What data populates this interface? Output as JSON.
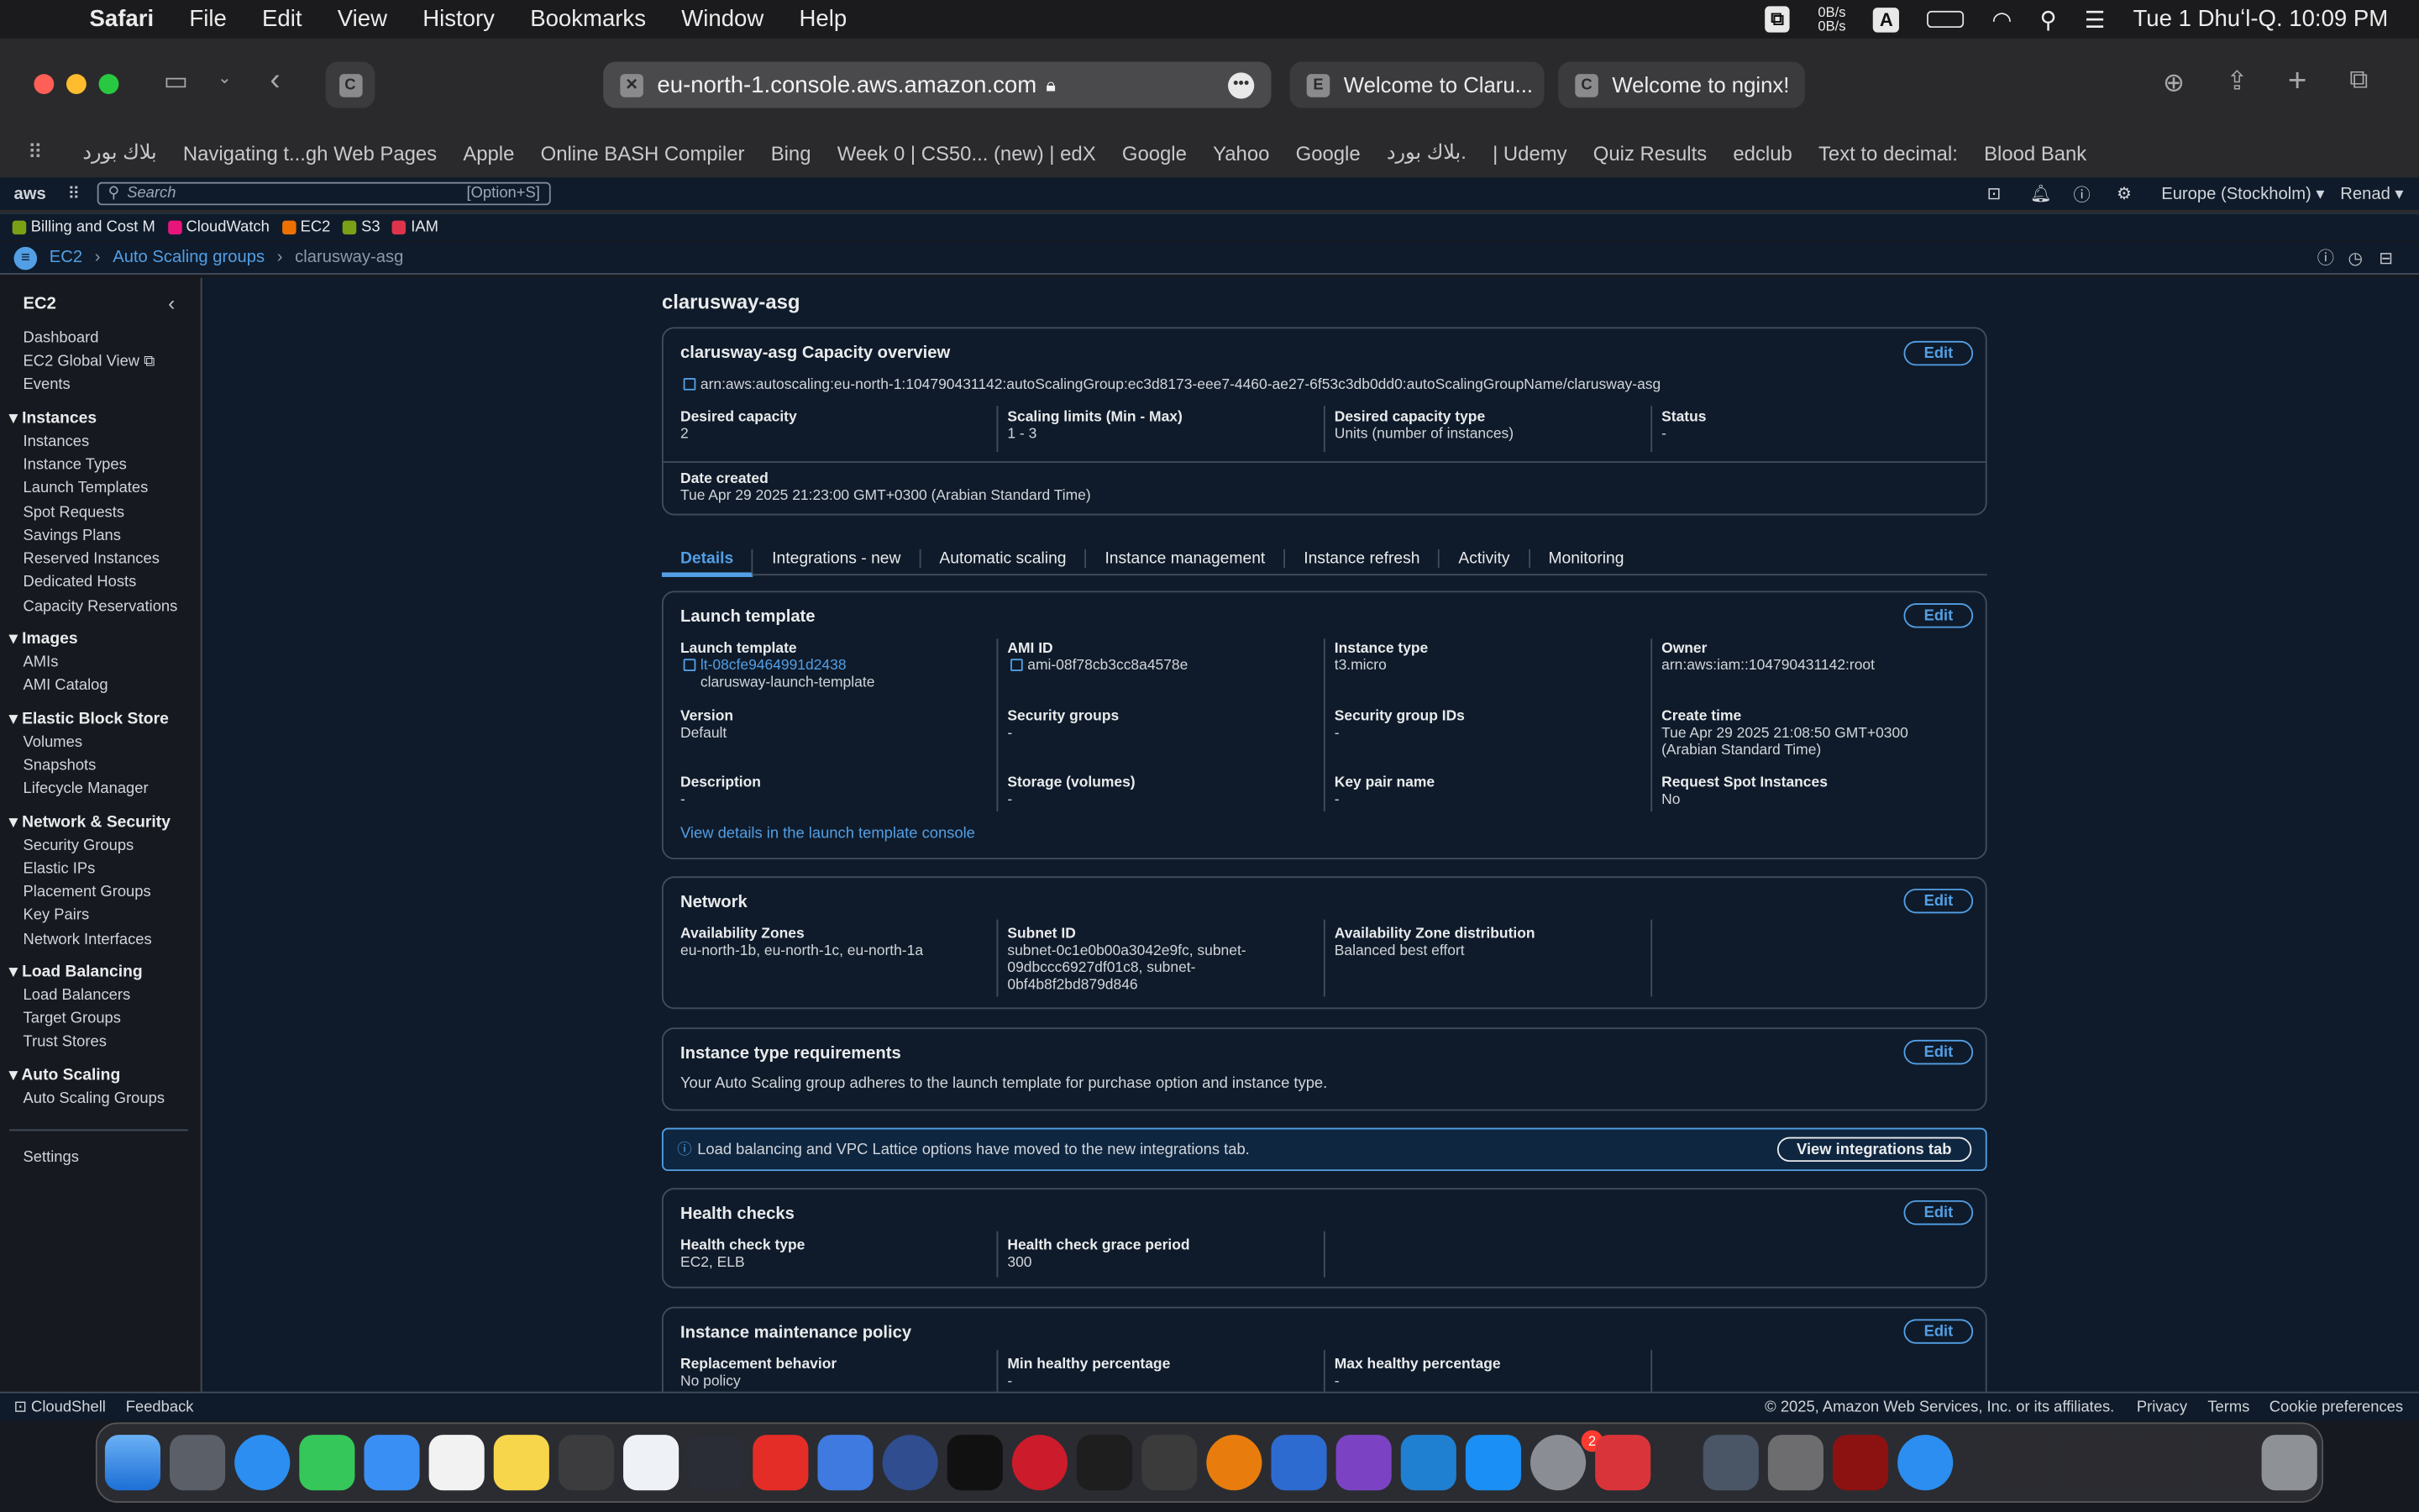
{
  "menubar": {
    "app": "Safari",
    "items": [
      "File",
      "Edit",
      "View",
      "History",
      "Bookmarks",
      "Window",
      "Help"
    ],
    "net_up": "0B/s",
    "net_down": "0B/s",
    "input_source": "A",
    "datetime": "Tue 1 Dhuʻl-Q.  10:09 PM"
  },
  "safari": {
    "url": "eu-north-1.console.aws.amazon.com",
    "current_tab_favicon": "C",
    "tabs": [
      {
        "favicon": "E",
        "label": "Welcome to Claru..."
      },
      {
        "favicon": "C",
        "label": "Welcome to nginx!"
      }
    ],
    "bookmarks": [
      "بلاك بورد",
      "Navigating t...gh Web Pages",
      "Apple",
      "Online BASH Compiler",
      "Bing",
      "Week 0 | CS50... (new) | edX",
      "Google",
      "Yahoo",
      "Google",
      "بلاك بورد.",
      "| Udemy",
      "Quiz Results",
      "edclub",
      "Text to decimal:",
      "Blood Bank"
    ]
  },
  "aws_nav": {
    "logo": "aws",
    "search_placeholder": "Search",
    "search_shortcut": "[Option+S]",
    "region": "Europe (Stockholm)",
    "user": "Renad",
    "services": [
      {
        "label": "Billing and Cost M",
        "color": "#7aa116"
      },
      {
        "label": "CloudWatch",
        "color": "#e7157b"
      },
      {
        "label": "EC2",
        "color": "#ed7100"
      },
      {
        "label": "S3",
        "color": "#7aa116"
      },
      {
        "label": "IAM",
        "color": "#dd344c"
      }
    ]
  },
  "breadcrumb": [
    "EC2",
    "Auto Scaling groups",
    "clarusway-asg"
  ],
  "sidebar": {
    "title": "EC2",
    "top": [
      "Dashboard",
      "EC2 Global View",
      "Events"
    ],
    "sections": [
      {
        "title": "Instances",
        "items": [
          "Instances",
          "Instance Types",
          "Launch Templates",
          "Spot Requests",
          "Savings Plans",
          "Reserved Instances",
          "Dedicated Hosts",
          "Capacity Reservations"
        ]
      },
      {
        "title": "Images",
        "items": [
          "AMIs",
          "AMI Catalog"
        ]
      },
      {
        "title": "Elastic Block Store",
        "items": [
          "Volumes",
          "Snapshots",
          "Lifecycle Manager"
        ]
      },
      {
        "title": "Network & Security",
        "items": [
          "Security Groups",
          "Elastic IPs",
          "Placement Groups",
          "Key Pairs",
          "Network Interfaces"
        ]
      },
      {
        "title": "Load Balancing",
        "items": [
          "Load Balancers",
          "Target Groups",
          "Trust Stores"
        ]
      },
      {
        "title": "Auto Scaling",
        "items": [
          "Auto Scaling Groups"
        ]
      }
    ],
    "settings": "Settings"
  },
  "page": {
    "title": "clarusway-asg",
    "edit": "Edit",
    "capacity": {
      "title": "clarusway-asg Capacity overview",
      "arn": "arn:aws:autoscaling:eu-north-1:104790431142:autoScalingGroup:ec3d8173-eee7-4460-ae27-6f53c3db0dd0:autoScalingGroupName/clarusway-asg",
      "desired_capacity_label": "Desired capacity",
      "desired_capacity": "2",
      "scaling_limits_label": "Scaling limits (Min - Max)",
      "scaling_limits": "1 - 3",
      "capacity_type_label": "Desired capacity type",
      "capacity_type": "Units (number of instances)",
      "status_label": "Status",
      "status": "-",
      "date_created_label": "Date created",
      "date_created": "Tue Apr 29 2025 21:23:00 GMT+0300 (Arabian Standard Time)"
    },
    "tabs": [
      "Details",
      "Integrations - new",
      "Automatic scaling",
      "Instance management",
      "Instance refresh",
      "Activity",
      "Monitoring"
    ],
    "launch_template": {
      "title": "Launch template",
      "lt_label": "Launch template",
      "lt_id": "lt-08cfe9464991d2438",
      "lt_name": "clarusway-launch-template",
      "ami_label": "AMI ID",
      "ami": "ami-08f78cb3cc8a4578e",
      "itype_label": "Instance type",
      "itype": "t3.micro",
      "owner_label": "Owner",
      "owner": "arn:aws:iam::104790431142:root",
      "version_label": "Version",
      "version": "Default",
      "sg_label": "Security groups",
      "sg": "-",
      "sgid_label": "Security group IDs",
      "sgid": "-",
      "create_label": "Create time",
      "create1": "Tue Apr 29 2025 21:08:50 GMT+0300",
      "create2": "(Arabian Standard Time)",
      "desc_label": "Description",
      "desc": "-",
      "storage_label": "Storage (volumes)",
      "storage": "-",
      "keypair_label": "Key pair name",
      "keypair": "-",
      "spot_label": "Request Spot Instances",
      "spot": "No",
      "view_link": "View details in the launch template console"
    },
    "network": {
      "title": "Network",
      "az_label": "Availability Zones",
      "az": "eu-north-1b, eu-north-1c, eu-north-1a",
      "subnet_label": "Subnet ID",
      "subnet1": "subnet-0c1e0b00a3042e9fc, subnet-",
      "subnet2": "09dbccc6927df01c8, subnet-",
      "subnet3": "0bf4b8f2bd879d846",
      "azd_label": "Availability Zone distribution",
      "azd": "Balanced best effort"
    },
    "itr": {
      "title": "Instance type requirements",
      "text": "Your Auto Scaling group adheres to the launch template for purchase option and instance type."
    },
    "banner": {
      "text": "Load balancing and VPC Lattice options have moved to the new integrations tab.",
      "button": "View integrations tab"
    },
    "health": {
      "title": "Health checks",
      "type_label": "Health check type",
      "type": "EC2, ELB",
      "grace_label": "Health check grace period",
      "grace": "300"
    },
    "maint": {
      "title": "Instance maintenance policy",
      "repl_label": "Replacement behavior",
      "repl": "No policy",
      "min_label": "Min healthy percentage",
      "min": "-",
      "max_label": "Max healthy percentage",
      "max": "-"
    }
  },
  "footer": {
    "cloudshell": "CloudShell",
    "feedback": "Feedback",
    "copyright": "© 2025, Amazon Web Services, Inc. or its affiliates.",
    "privacy": "Privacy",
    "terms": "Terms",
    "cookies": "Cookie preferences"
  },
  "dock": {
    "badge": "2"
  }
}
